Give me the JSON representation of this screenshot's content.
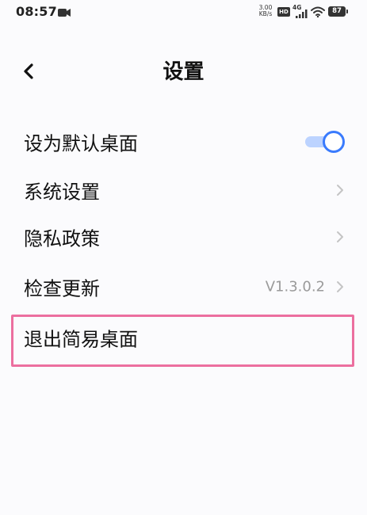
{
  "status_bar": {
    "time": "08:57",
    "net_speed_value": "3.00",
    "net_speed_unit": "KB/s",
    "hd_label": "HD",
    "network_type": "4G",
    "battery_level": "87",
    "video_icon": "video-camera-icon",
    "wifi_icon": "wifi-icon",
    "signal_icon": "signal-bars-icon"
  },
  "header": {
    "back_icon": "chevron-left-icon",
    "title": "设置"
  },
  "settings": {
    "items": [
      {
        "label": "设为默认桌面",
        "control": "toggle",
        "on": true
      },
      {
        "label": "系统设置",
        "control": "chevron"
      },
      {
        "label": "隐私政策",
        "control": "chevron"
      },
      {
        "label": "检查更新",
        "control": "chevron",
        "value": "V1.3.0.2"
      },
      {
        "label": "退出简易桌面",
        "control": "none",
        "highlighted": true
      }
    ]
  },
  "colors": {
    "accent": "#3a7bfd",
    "toggle_track": "#bcd3ff",
    "highlight_border": "#ec6f9f",
    "secondary_text": "#9a9a9a",
    "background": "#fbfbfd"
  }
}
